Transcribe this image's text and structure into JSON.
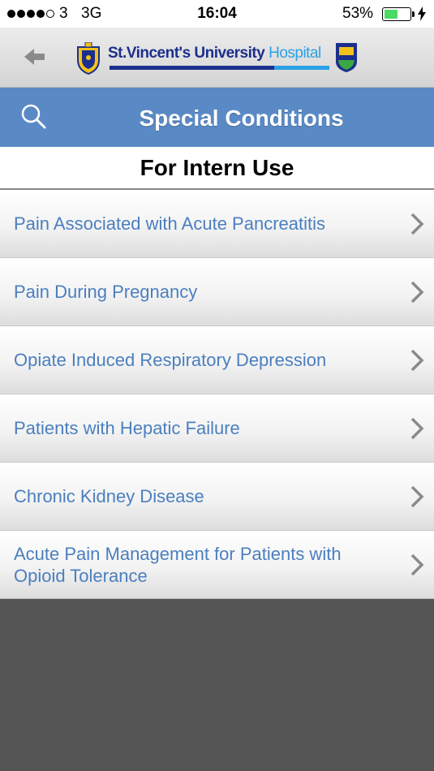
{
  "status_bar": {
    "carrier": "3",
    "network": "3G",
    "time": "16:04",
    "battery_percent": "53%",
    "battery_level": 0.53,
    "signal_bars_filled": 4,
    "signal_bars_total": 5
  },
  "header": {
    "logo_text_main": "St.Vincent's University",
    "logo_text_highlight": "Hospital",
    "left_crest_icon": "svuh-crest-icon",
    "right_crest_icon": "ucd-crest-icon",
    "brand_colors": {
      "navy": "#1c2f8c",
      "blue": "#2aa0e6"
    }
  },
  "title_bar": {
    "title": "Special Conditions",
    "background": "#5a8ac6"
  },
  "section": {
    "heading": "For Intern Use"
  },
  "list": {
    "items": [
      {
        "label": "Pain Associated with Acute Pancreatitis"
      },
      {
        "label": "Pain During Pregnancy"
      },
      {
        "label": "Opiate Induced Respiratory Depression"
      },
      {
        "label": "Patients with Hepatic Failure"
      },
      {
        "label": "Chronic Kidney Disease"
      },
      {
        "label": "Acute Pain Management for Patients with Opioid Tolerance"
      }
    ],
    "text_color": "#4b7fbf"
  }
}
